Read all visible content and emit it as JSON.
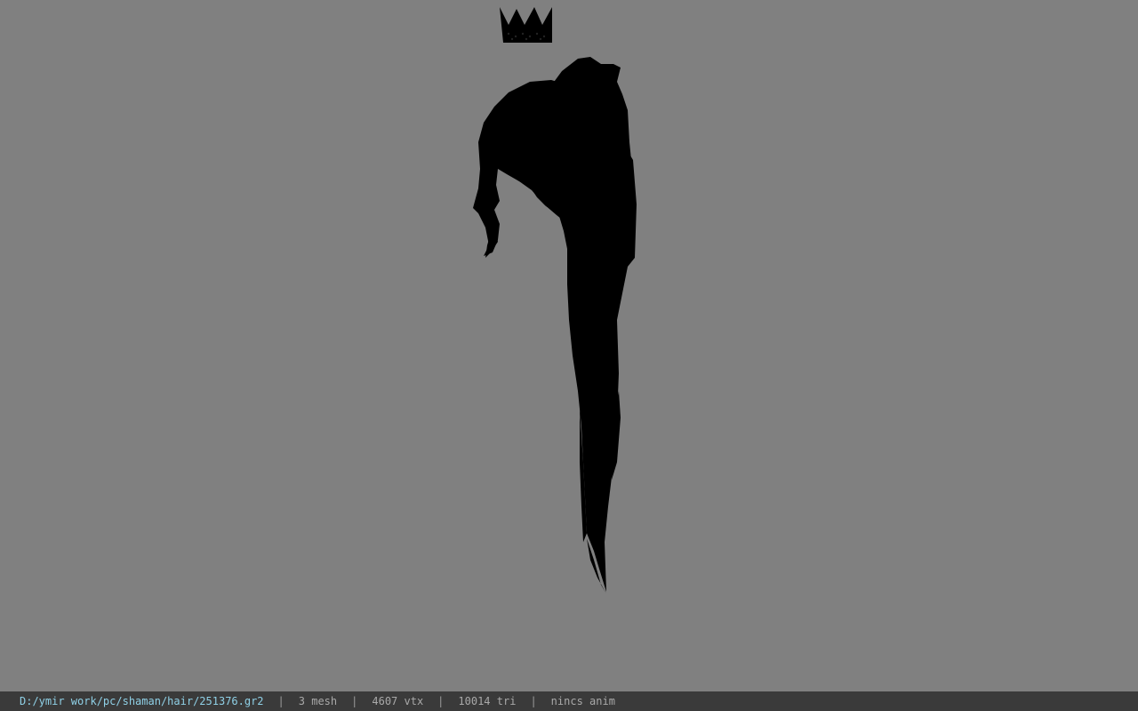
{
  "viewport": {
    "background": "#808080",
    "model_color": "#000000",
    "crown_icon": "crown-icon"
  },
  "status_bar": {
    "file_path": "D:/ymir work/pc/shaman/hair/251376.gr2",
    "mesh_count": "3 mesh",
    "vertex_count": "4607 vtx",
    "triangle_count": "10014 tri",
    "anim_status": "nincs anim",
    "separator": "|",
    "path_color": "#8fd0e6"
  }
}
